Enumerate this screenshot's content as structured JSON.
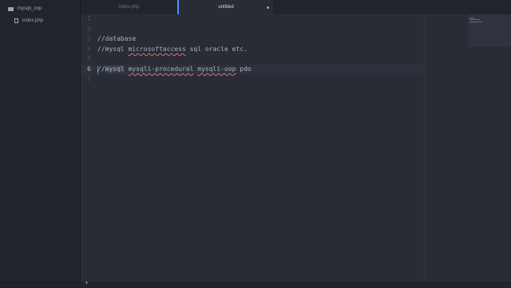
{
  "tree": {
    "root": "mysqli_oop",
    "files": [
      "index.php"
    ]
  },
  "tabs": [
    {
      "label": "index.php",
      "active": false
    },
    {
      "label": "untitled",
      "active": true,
      "modified": true
    }
  ],
  "editor": {
    "active_line": 6,
    "lines": [
      {
        "n": "1",
        "text": ""
      },
      {
        "n": "2",
        "text": ""
      },
      {
        "n": "3",
        "text": "//database"
      },
      {
        "n": "4",
        "parts": [
          "//mysql ",
          "microsoftaccess",
          " sql oracle etc."
        ]
      },
      {
        "n": "5",
        "text": ""
      },
      {
        "n": "6",
        "parts": [
          "//",
          "mysql",
          " ",
          "mysqli-procedural",
          " ",
          "mysqli-oop",
          " pdo"
        ]
      },
      {
        "n": "7",
        "text": ""
      }
    ]
  },
  "status": {
    "add_label": "+"
  },
  "colors": {
    "accent": "#528bff",
    "editor_bg": "#282c34",
    "sidebar_bg": "#21252b",
    "spell_error": "#e06c75"
  }
}
